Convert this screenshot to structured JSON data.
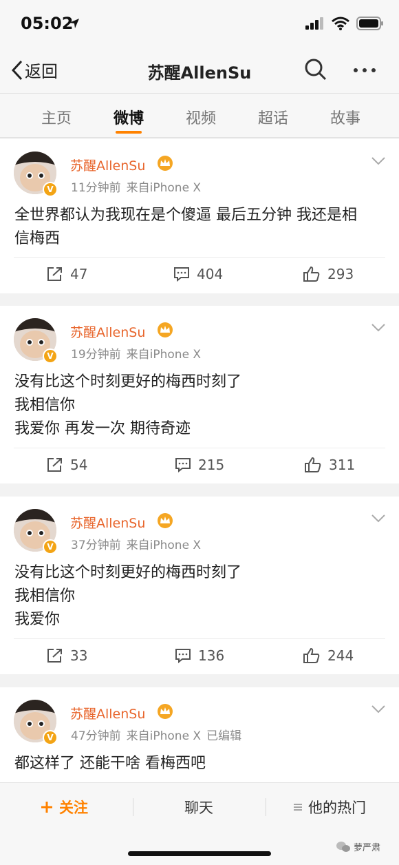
{
  "status_bar": {
    "time": "05:02"
  },
  "nav": {
    "back_label": "返回",
    "title": "苏醒AllenSu"
  },
  "tabs": [
    "主页",
    "微博",
    "视频",
    "超话",
    "故事"
  ],
  "posts": [
    {
      "author": "苏醒AllenSu",
      "time": "11分钟前",
      "source": "来自iPhone X",
      "edited": "",
      "lines": [
        "全世界都认为我现在是个傻逼 最后五分钟 我还是相",
        "信梅西"
      ],
      "reposts": "47",
      "comments": "404",
      "likes": "293"
    },
    {
      "author": "苏醒AllenSu",
      "time": "19分钟前",
      "source": "来自iPhone X",
      "edited": "",
      "lines": [
        "没有比这个时刻更好的梅西时刻了",
        "我相信你",
        "我爱你 再发一次 期待奇迹"
      ],
      "reposts": "54",
      "comments": "215",
      "likes": "311"
    },
    {
      "author": "苏醒AllenSu",
      "time": "37分钟前",
      "source": "来自iPhone X",
      "edited": "",
      "lines": [
        "没有比这个时刻更好的梅西时刻了",
        "我相信你",
        "我爱你"
      ],
      "reposts": "33",
      "comments": "136",
      "likes": "244"
    },
    {
      "author": "苏醒AllenSu",
      "time": "47分钟前",
      "source": "来自iPhone X",
      "edited": "已编辑",
      "lines": [
        "都这样了 还能干啥 看梅西吧"
      ],
      "reposts": "",
      "comments": "",
      "likes": ""
    }
  ],
  "verified_badge": "V",
  "bottom_bar": {
    "follow_label": "关注",
    "chat_label": "聊天",
    "hot_label": "他的热门"
  },
  "watermark": "萝严肃",
  "colors": {
    "accent": "#ff8200",
    "author": "#e8662d",
    "badge": "#f3a415"
  }
}
